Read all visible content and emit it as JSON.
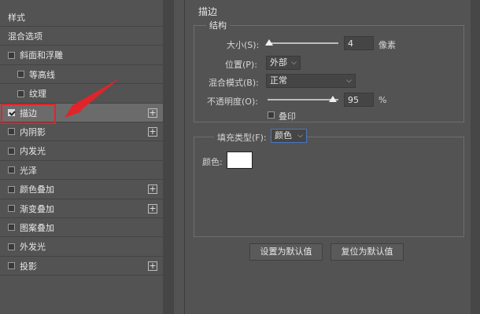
{
  "left_panel": {
    "items": [
      {
        "label": "样式",
        "checkbox": false,
        "checked": false,
        "plus": false,
        "indent": false
      },
      {
        "label": "混合选项",
        "checkbox": false,
        "checked": false,
        "plus": false,
        "indent": false
      },
      {
        "label": "斜面和浮雕",
        "checkbox": true,
        "checked": false,
        "plus": false,
        "indent": false
      },
      {
        "label": "等高线",
        "checkbox": true,
        "checked": false,
        "plus": false,
        "indent": true
      },
      {
        "label": "纹理",
        "checkbox": true,
        "checked": false,
        "plus": false,
        "indent": true
      },
      {
        "label": "描边",
        "checkbox": true,
        "checked": true,
        "plus": true,
        "indent": false,
        "selected": true
      },
      {
        "label": "内阴影",
        "checkbox": true,
        "checked": false,
        "plus": true,
        "indent": false
      },
      {
        "label": "内发光",
        "checkbox": true,
        "checked": false,
        "plus": false,
        "indent": false
      },
      {
        "label": "光泽",
        "checkbox": true,
        "checked": false,
        "plus": false,
        "indent": false
      },
      {
        "label": "颜色叠加",
        "checkbox": true,
        "checked": false,
        "plus": true,
        "indent": false
      },
      {
        "label": "渐变叠加",
        "checkbox": true,
        "checked": false,
        "plus": true,
        "indent": false
      },
      {
        "label": "图案叠加",
        "checkbox": true,
        "checked": false,
        "plus": false,
        "indent": false
      },
      {
        "label": "外发光",
        "checkbox": true,
        "checked": false,
        "plus": false,
        "indent": false
      },
      {
        "label": "投影",
        "checkbox": true,
        "checked": false,
        "plus": true,
        "indent": false
      }
    ]
  },
  "stroke_panel": {
    "title": "描边",
    "structure_title": "结构",
    "size_label": "大小(S):",
    "size_value": "4",
    "size_unit": "像素",
    "position_label": "位置(P):",
    "position_value": "外部",
    "blend_label": "混合模式(B):",
    "blend_value": "正常",
    "opacity_label": "不透明度(O):",
    "opacity_value": "95",
    "opacity_unit": "%",
    "overprint_label": "叠印",
    "fill_type_label": "填充类型(F):",
    "fill_type_value": "颜色",
    "color_label": "颜色:",
    "color_value": "#ffffff",
    "set_default": "设置为默认值",
    "reset_default": "复位为默认值"
  },
  "accent": {
    "highlight": "#e0242a",
    "arrow": "#e0242a"
  }
}
